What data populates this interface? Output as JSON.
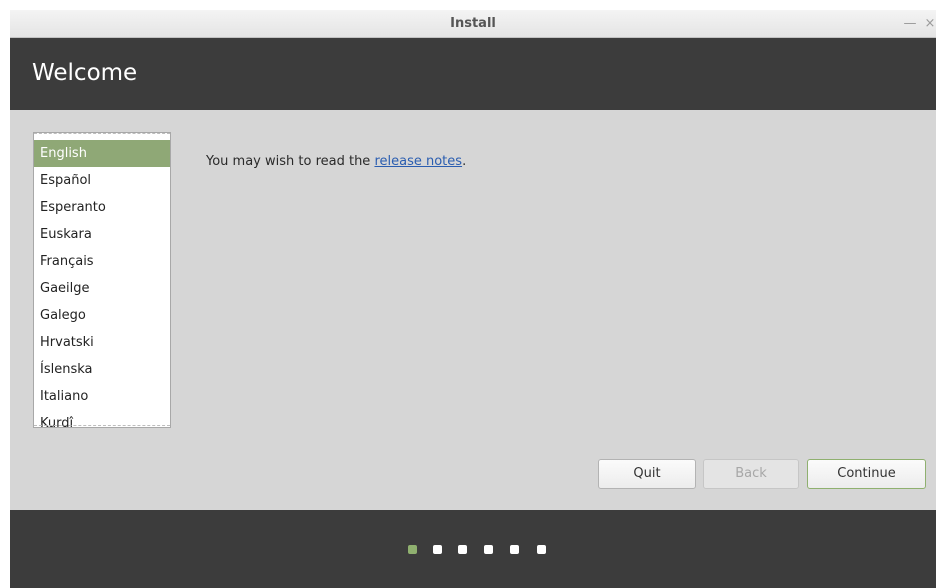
{
  "window": {
    "title": "Install",
    "minimize_icon": "—",
    "close_icon": "×"
  },
  "header": {
    "title": "Welcome"
  },
  "languages": {
    "selected_index": 0,
    "items": [
      {
        "label": "English"
      },
      {
        "label": "Español"
      },
      {
        "label": "Esperanto"
      },
      {
        "label": "Euskara"
      },
      {
        "label": "Français"
      },
      {
        "label": "Gaeilge"
      },
      {
        "label": "Galego"
      },
      {
        "label": "Hrvatski"
      },
      {
        "label": "Íslenska"
      },
      {
        "label": "Italiano"
      },
      {
        "label": "Kurdî"
      }
    ]
  },
  "notes": {
    "prefix": "You may wish to read the ",
    "link": "release notes",
    "suffix": "."
  },
  "buttons": {
    "quit": "Quit",
    "back": "Back",
    "continue": "Continue"
  },
  "progress": {
    "total_steps": 6,
    "current_step": 1
  },
  "colors": {
    "accent": "#8fb06f",
    "selection": "#8fa876",
    "dark_panel": "#3c3c3c",
    "link": "#2a5db0"
  }
}
